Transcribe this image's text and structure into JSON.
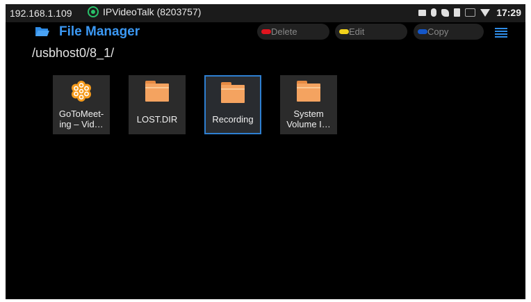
{
  "status_bar": {
    "ip": "192.168.1.109",
    "app_name": "IPVideoTalk (8203757)",
    "time": "17:29",
    "icons": [
      "photo-icon",
      "mouse-icon",
      "phone-icon",
      "sd-card-icon",
      "ethernet-icon",
      "wifi-icon"
    ]
  },
  "header": {
    "title": "File Manager",
    "actions": [
      {
        "label": "Delete",
        "color": "#e0141e"
      },
      {
        "label": "Edit",
        "color": "#f2d21b"
      },
      {
        "label": "Copy",
        "color": "#1456c8"
      }
    ],
    "menu_icon": "menu-icon"
  },
  "path": "/usbhost0/8_1/",
  "files": [
    {
      "name": "GoToMeet-\ning – Vid…",
      "type": "app"
    },
    {
      "name": "LOST.DIR",
      "type": "folder"
    },
    {
      "name": "Recording",
      "type": "folder",
      "selected": true
    },
    {
      "name": "System\nVolume I…",
      "type": "folder"
    }
  ],
  "colors": {
    "accent": "#3b98f3",
    "selection_border": "#2e7fd1",
    "folder": "#f4a360",
    "app_icon": "#f59b1c"
  }
}
